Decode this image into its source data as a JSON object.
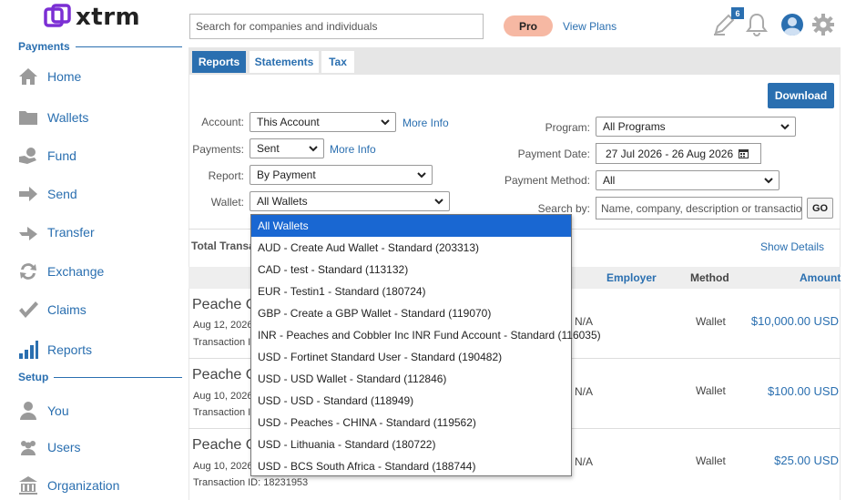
{
  "brand": {
    "name": "xtrm",
    "accent": "#7b2fd4"
  },
  "colors": {
    "primary": "#2a6fb0",
    "pro_badge": "#f6b8a3",
    "selected_option": "#1967d2"
  },
  "sidebar": {
    "sections": [
      {
        "title": "Payments"
      },
      {
        "title": "Setup"
      }
    ],
    "items": [
      {
        "label": "Home",
        "icon": "home-icon"
      },
      {
        "label": "Wallets",
        "icon": "folder-icon"
      },
      {
        "label": "Fund",
        "icon": "hand-coin-icon"
      },
      {
        "label": "Send",
        "icon": "arrow-right-icon"
      },
      {
        "label": "Transfer",
        "icon": "transfer-arrow-icon"
      },
      {
        "label": "Exchange",
        "icon": "exchange-icon"
      },
      {
        "label": "Claims",
        "icon": "checkmark-icon"
      },
      {
        "label": "Reports",
        "icon": "bar-chart-icon"
      },
      {
        "label": "You",
        "icon": "user-icon"
      },
      {
        "label": "Users",
        "icon": "users-icon"
      },
      {
        "label": "Organization",
        "icon": "building-icon"
      }
    ]
  },
  "topbar": {
    "search_placeholder": "Search for companies and individuals",
    "pro_label": "Pro",
    "view_plans": "View Plans",
    "notes_badge": "6"
  },
  "tabs": [
    {
      "label": "Reports",
      "active": true
    },
    {
      "label": "Statements",
      "active": false
    },
    {
      "label": "Tax",
      "active": false
    }
  ],
  "download_label": "Download",
  "filters": {
    "account": {
      "label": "Account:",
      "value": "This Account",
      "more_info": "More Info"
    },
    "payments": {
      "label": "Payments:",
      "value": "Sent",
      "more_info": "More Info"
    },
    "report": {
      "label": "Report:",
      "value": "By Payment"
    },
    "wallet": {
      "label": "Wallet:",
      "value": "All Wallets"
    },
    "program": {
      "label": "Program:",
      "value": "All Programs"
    },
    "payment_date": {
      "label": "Payment Date:",
      "value": "27 Jul 2026 - 26 Aug 2026"
    },
    "payment_method": {
      "label": "Payment Method:",
      "value": "All"
    },
    "search_by": {
      "label": "Search by:",
      "placeholder": "Name, company, description or transaction #",
      "go": "GO"
    }
  },
  "summary": {
    "total_label": "Total Transa",
    "show_details": "Show Details"
  },
  "table": {
    "headers": {
      "employer": "Employer",
      "method": "Method",
      "amount": "Amount"
    },
    "rows": [
      {
        "name": "Peache C",
        "date": "Aug 12, 2026",
        "tx": "Transaction I",
        "employer": "N/A",
        "method": "Wallet",
        "amount": "$10,000.00 USD"
      },
      {
        "name": "Peache C",
        "date": "Aug 10, 2026",
        "tx": "Transaction I",
        "employer": "N/A",
        "method": "Wallet",
        "amount": "$100.00 USD"
      },
      {
        "name": "Peache C",
        "date": "Aug 10, 2026",
        "tx": "Transaction ID: 18231953",
        "employer": "N/A",
        "method": "Wallet",
        "amount": "$25.00 USD"
      }
    ]
  },
  "wallet_dropdown": {
    "options": [
      "All Wallets",
      "AUD - Create Aud Wallet - Standard (203313)",
      "CAD - test - Standard (113132)",
      "EUR - Testin1 - Standard (180724)",
      "GBP - Create a GBP Wallet - Standard (119070)",
      "INR - Peaches and Cobbler Inc INR Fund Account - Standard (116035)",
      "USD - Fortinet Standard User - Standard (190482)",
      "USD - USD Wallet - Standard (112846)",
      "USD - USD - Standard (118949)",
      "USD - Peaches - CHINA - Standard (119562)",
      "USD - Lithuania - Standard (180722)",
      "USD - BCS South Africa - Standard (188744)"
    ],
    "selected_index": 0
  }
}
